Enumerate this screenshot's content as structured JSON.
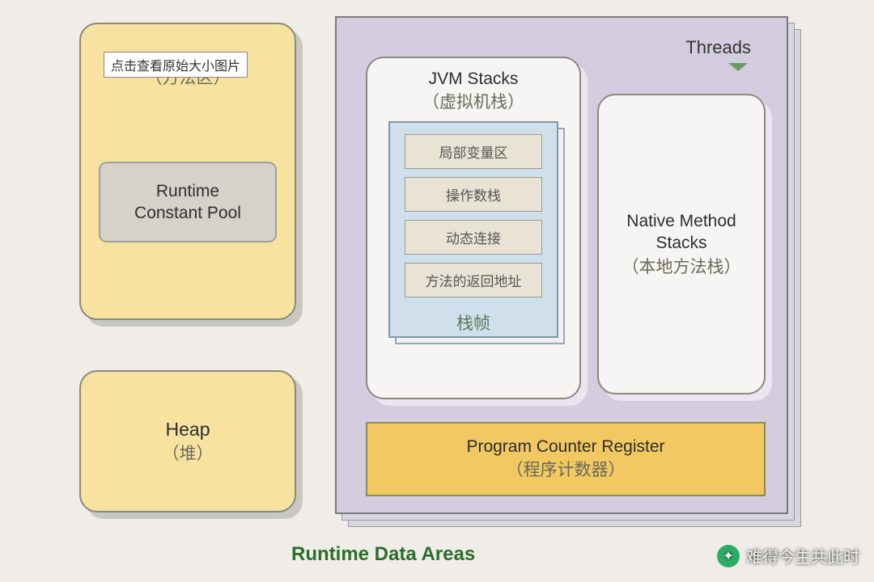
{
  "methodArea": {
    "hint": "点击查看原始大小图片",
    "sub": "（方法区）",
    "pool": "Runtime\nConstant Pool"
  },
  "heap": {
    "title": "Heap",
    "sub": "（堆）"
  },
  "threads": {
    "label": "Threads",
    "jvmStacks": {
      "title": "JVM Stacks",
      "sub": "（虚拟机栈）"
    },
    "stackFrame": {
      "items": [
        "局部变量区",
        "操作数栈",
        "动态连接",
        "方法的返回地址"
      ],
      "title": "栈帧"
    },
    "native": {
      "title": "Native Method\nStacks",
      "sub": "（本地方法栈）"
    },
    "pcr": {
      "title": "Program Counter Register",
      "sub": "（程序计数器）"
    }
  },
  "footer": "Runtime Data Areas",
  "watermark": "难得今生共此时"
}
